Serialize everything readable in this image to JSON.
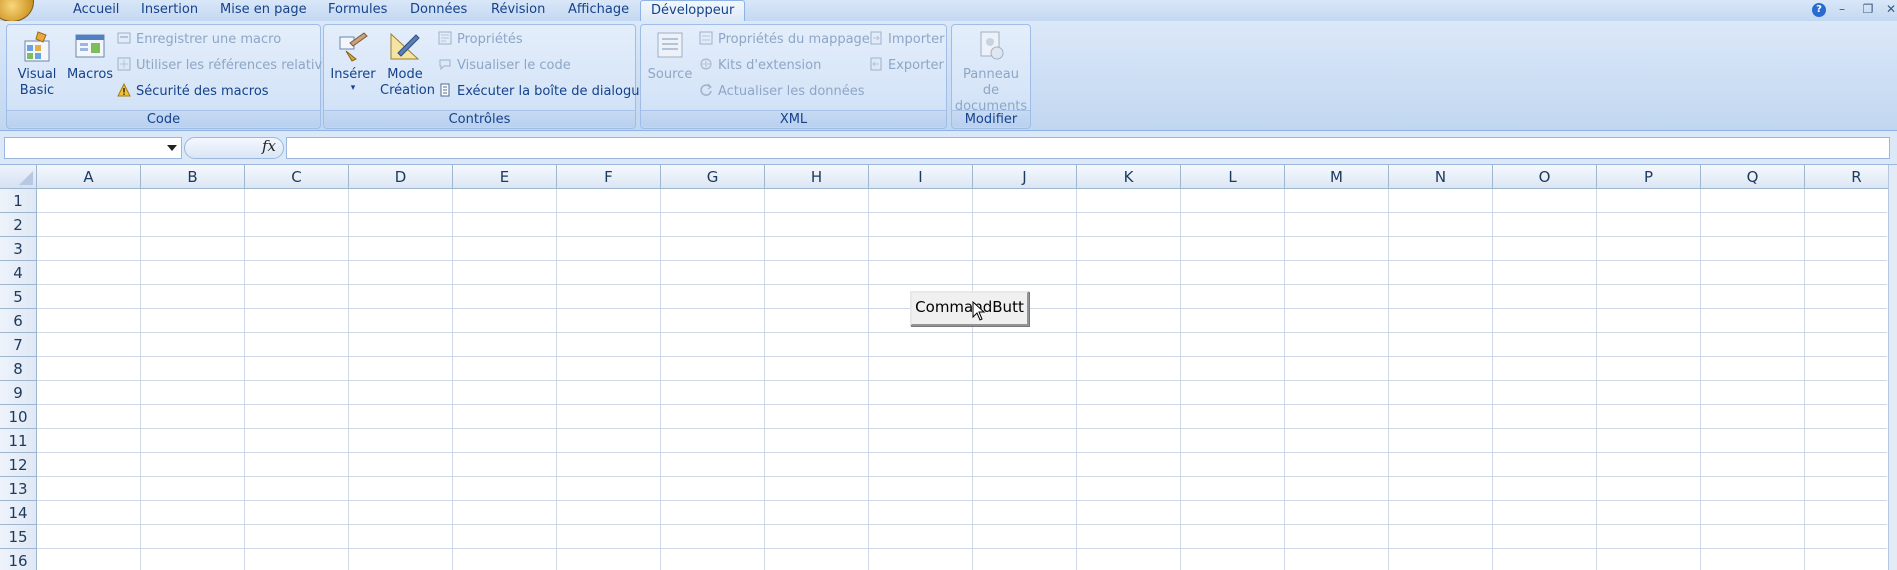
{
  "tabs": [
    "Accueil",
    "Insertion",
    "Mise en page",
    "Formules",
    "Données",
    "Révision",
    "Affichage",
    "Développeur"
  ],
  "active_tab": "Développeur",
  "window_controls": {
    "help": "?",
    "minimize": "–",
    "restore": "❐",
    "close": "✕"
  },
  "ribbon": {
    "code": {
      "label": "Code",
      "visual_basic": [
        "Visual",
        "Basic"
      ],
      "macros": "Macros",
      "record_macro": "Enregistrer une macro",
      "relative_refs": "Utiliser les références relatives",
      "macro_security": "Sécurité des macros"
    },
    "controls": {
      "label": "Contrôles",
      "insert": "Insérer",
      "design_mode": [
        "Mode",
        "Création"
      ],
      "properties": "Propriétés",
      "view_code": "Visualiser le code",
      "run_dialog": "Exécuter la boîte de dialogue"
    },
    "xml": {
      "label": "XML",
      "source": "Source",
      "map_properties": "Propriétés du mappage",
      "expansion_packs": "Kits d'extension",
      "refresh_data": "Actualiser les données",
      "import": "Importer",
      "export": "Exporter"
    },
    "modify": {
      "label": "Modifier",
      "document_panel": [
        "Panneau de",
        "documents"
      ]
    }
  },
  "formula_bar": {
    "name_box": "",
    "fx": "fx",
    "formula": ""
  },
  "columns": [
    "A",
    "B",
    "C",
    "D",
    "E",
    "F",
    "G",
    "H",
    "I",
    "J",
    "K",
    "L",
    "M",
    "N",
    "O",
    "P",
    "Q",
    "R"
  ],
  "rows": [
    "1",
    "2",
    "3",
    "4",
    "5",
    "6",
    "7",
    "8",
    "9",
    "10",
    "11",
    "12",
    "13",
    "14",
    "15",
    "16"
  ],
  "command_button": {
    "label": "CommandButt"
  }
}
